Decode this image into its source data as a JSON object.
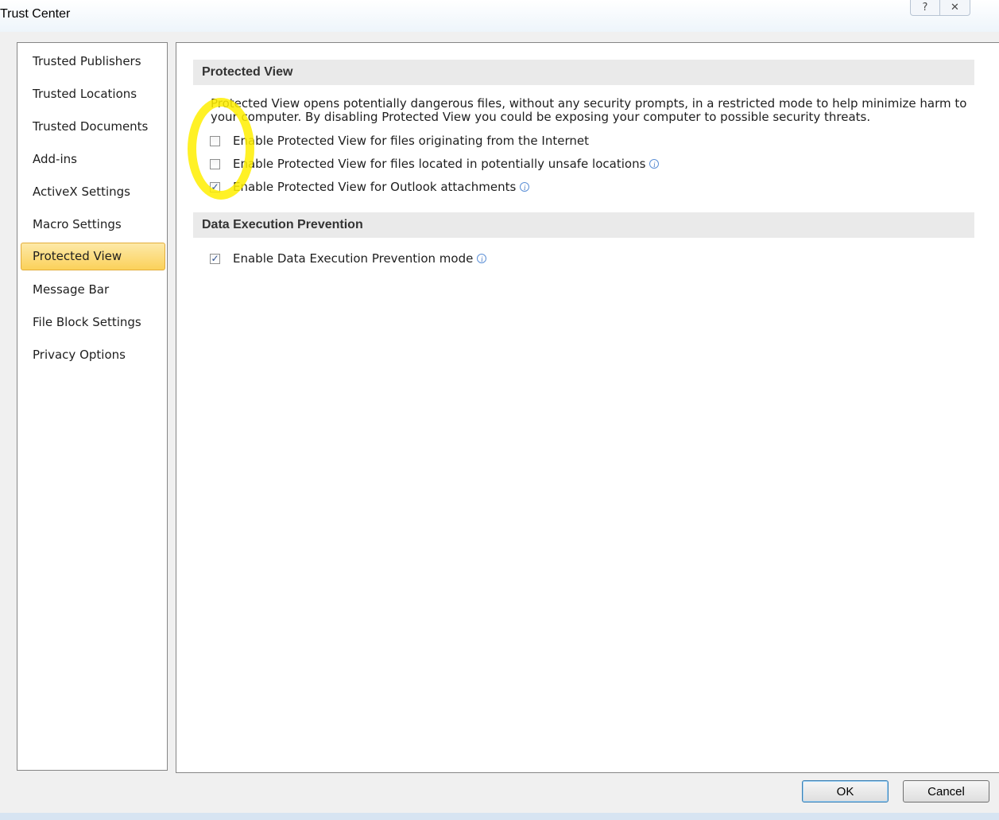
{
  "window": {
    "title": "Trust Center",
    "help_glyph": "?",
    "close_glyph": "✕"
  },
  "nav": {
    "items": [
      {
        "label": "Trusted Publishers",
        "selected": false
      },
      {
        "label": "Trusted Locations",
        "selected": false
      },
      {
        "label": "Trusted Documents",
        "selected": false
      },
      {
        "label": "Add-ins",
        "selected": false
      },
      {
        "label": "ActiveX Settings",
        "selected": false
      },
      {
        "label": "Macro Settings",
        "selected": false
      },
      {
        "label": "Protected View",
        "selected": true
      },
      {
        "label": "Message Bar",
        "selected": false
      },
      {
        "label": "File Block Settings",
        "selected": false
      },
      {
        "label": "Privacy Options",
        "selected": false
      }
    ]
  },
  "protected_view": {
    "header": "Protected View",
    "description": "Protected View opens potentially dangerous files, without any security prompts, in a restricted mode to help minimize harm to your computer. By disabling Protected View you could be exposing your computer to possible security threats.",
    "options": [
      {
        "label": "Enable Protected View for files originating from the Internet",
        "checked": false,
        "info": false
      },
      {
        "label": "Enable Protected View for files located in potentially unsafe locations",
        "checked": false,
        "info": true
      },
      {
        "label": "Enable Protected View for Outlook attachments",
        "checked": true,
        "info": true
      }
    ]
  },
  "dep": {
    "header": "Data Execution Prevention",
    "option_label": "Enable Data Execution Prevention mode",
    "checked": true
  },
  "buttons": {
    "ok": "OK",
    "cancel": "Cancel"
  },
  "glyphs": {
    "check": "✓",
    "info": "i"
  },
  "colors": {
    "selected_nav": "#fbd15a",
    "highlight_annotation": "#ffee00",
    "section_header_bg": "#eaeaea"
  }
}
